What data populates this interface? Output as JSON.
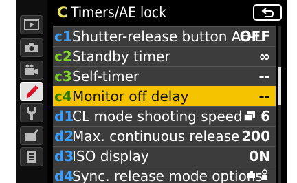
{
  "menu": {
    "title_letter": "C",
    "title": "Timers/AE lock",
    "back_icon": "back-arrow-icon",
    "sidebar_icons": [
      {
        "name": "playback-menu-icon",
        "active": false
      },
      {
        "name": "photo-shooting-menu-icon",
        "active": false
      },
      {
        "name": "movie-shooting-menu-icon",
        "active": false
      },
      {
        "name": "custom-settings-menu-icon",
        "active": true
      },
      {
        "name": "setup-menu-icon",
        "active": false
      },
      {
        "name": "retouch-menu-icon",
        "active": false
      },
      {
        "name": "my-menu-icon",
        "active": false
      }
    ],
    "items": [
      {
        "code": "c1",
        "label": "Shutter-release button AE-L",
        "value": "OFF"
      },
      {
        "code": "c2",
        "label": "Standby timer",
        "value": "∞"
      },
      {
        "code": "c3",
        "label": "Self-timer",
        "value": "--"
      },
      {
        "code": "c4",
        "label": "Monitor off delay",
        "value": "--"
      },
      {
        "code": "d1",
        "label": "CL mode shooting speed",
        "value": "6"
      },
      {
        "code": "d2",
        "label": "Max. continuous release",
        "value": "200"
      },
      {
        "code": "d3",
        "label": "ISO display",
        "value": "0N"
      },
      {
        "code": "d4",
        "label": "Sync. release mode options",
        "value": ""
      }
    ],
    "selected_index": 3,
    "colors": {
      "highlight": "#f5c400",
      "code_blue": "#3aa0ff",
      "code_green": "#7ed321",
      "title_yellow": "#e5e060"
    }
  }
}
